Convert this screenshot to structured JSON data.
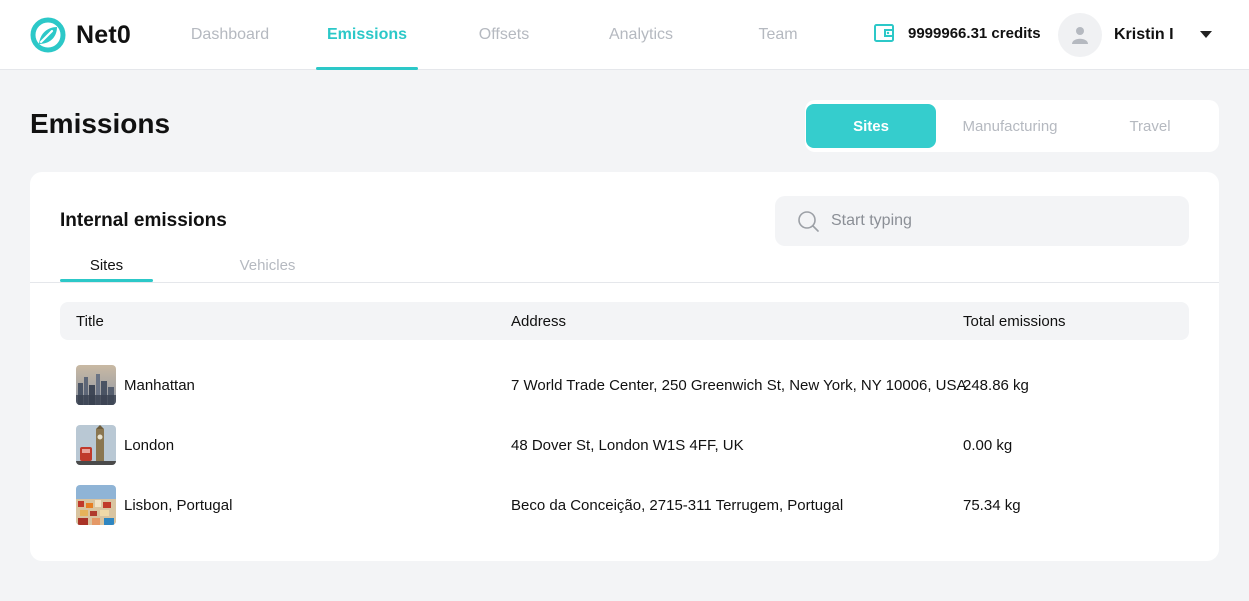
{
  "app": {
    "brand": "Net0",
    "colors": {
      "accent": "#2cc8c8",
      "muted": "#b5b9c0",
      "background": "#f3f4f6"
    }
  },
  "nav": {
    "items": [
      {
        "label": "Dashboard",
        "active": false
      },
      {
        "label": "Emissions",
        "active": true
      },
      {
        "label": "Offsets",
        "active": false
      },
      {
        "label": "Analytics",
        "active": false
      },
      {
        "label": "Team",
        "active": false
      }
    ]
  },
  "header": {
    "credits": "9999966.31 credits",
    "user_name": "Kristin I",
    "icons": {
      "wallet": "wallet-icon",
      "avatar": "user-icon",
      "menu": "chevron-down-icon"
    }
  },
  "page": {
    "title": "Emissions",
    "segments": [
      {
        "label": "Sites",
        "active": true
      },
      {
        "label": "Manufacturing",
        "active": false
      },
      {
        "label": "Travel",
        "active": false
      }
    ]
  },
  "card": {
    "title": "Internal emissions",
    "search_placeholder": "Start typing",
    "search_value": "",
    "subtabs": [
      {
        "label": "Sites",
        "active": true
      },
      {
        "label": "Vehicles",
        "active": false
      }
    ],
    "table": {
      "columns": [
        "Title",
        "Address",
        "Total emissions"
      ],
      "rows": [
        {
          "title": "Manhattan",
          "address": "7 World Trade Center, 250 Greenwich St, New York, NY 10006, USA",
          "total": "248.86 kg",
          "thumb": "city-skyline"
        },
        {
          "title": "London",
          "address": "48 Dover St, London W1S 4FF, UK",
          "total": "0.00 kg",
          "thumb": "big-ben"
        },
        {
          "title": "Lisbon, Portugal",
          "address": "Beco da Conceição, 2715-311 Terrugem, Portugal",
          "total": "75.34 kg",
          "thumb": "lisbon-rooftops"
        }
      ]
    }
  }
}
